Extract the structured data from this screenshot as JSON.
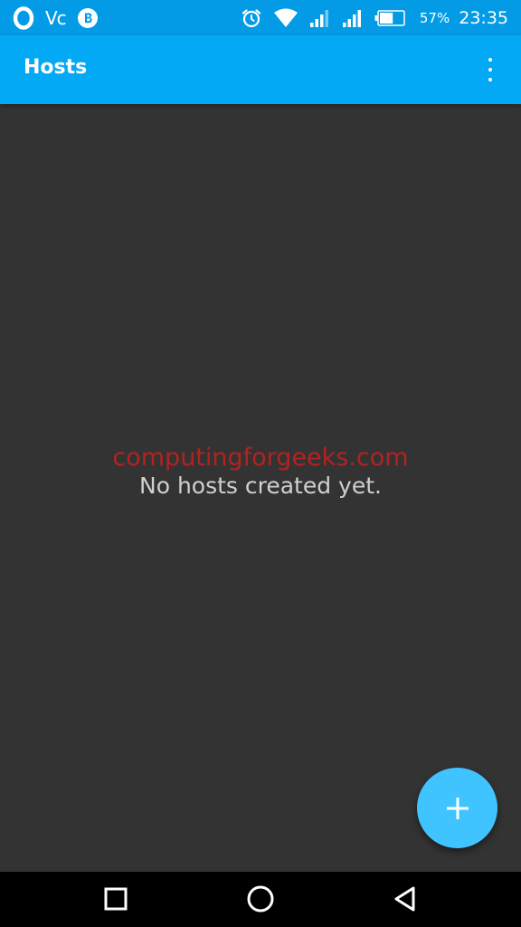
{
  "status_bar": {
    "left_icons": [
      "opera-icon",
      "volte-icon",
      "bitcoin-icon"
    ],
    "volte_label": "Vc",
    "alarm_icon": "alarm-clock-icon",
    "wifi_icon": "wifi-icon",
    "signal_icons": [
      "signal-icon",
      "signal-icon"
    ],
    "battery_icon": "battery-icon",
    "battery_percent": "57%",
    "battery_level": 0.57,
    "time": "23:35"
  },
  "app_bar": {
    "title": "Hosts",
    "overflow_icon": "more-vertical-icon"
  },
  "content": {
    "watermark": "computingforgeeks.com",
    "empty_message": "No hosts created yet."
  },
  "fab": {
    "icon": "plus-icon",
    "color": "#40c4ff"
  },
  "nav_bar": {
    "buttons": [
      "recent-apps-icon",
      "home-icon",
      "back-icon"
    ]
  },
  "colors": {
    "status_bar": "#039be5",
    "app_bar": "#03a9f4",
    "background": "#333333",
    "watermark": "#b22222"
  }
}
